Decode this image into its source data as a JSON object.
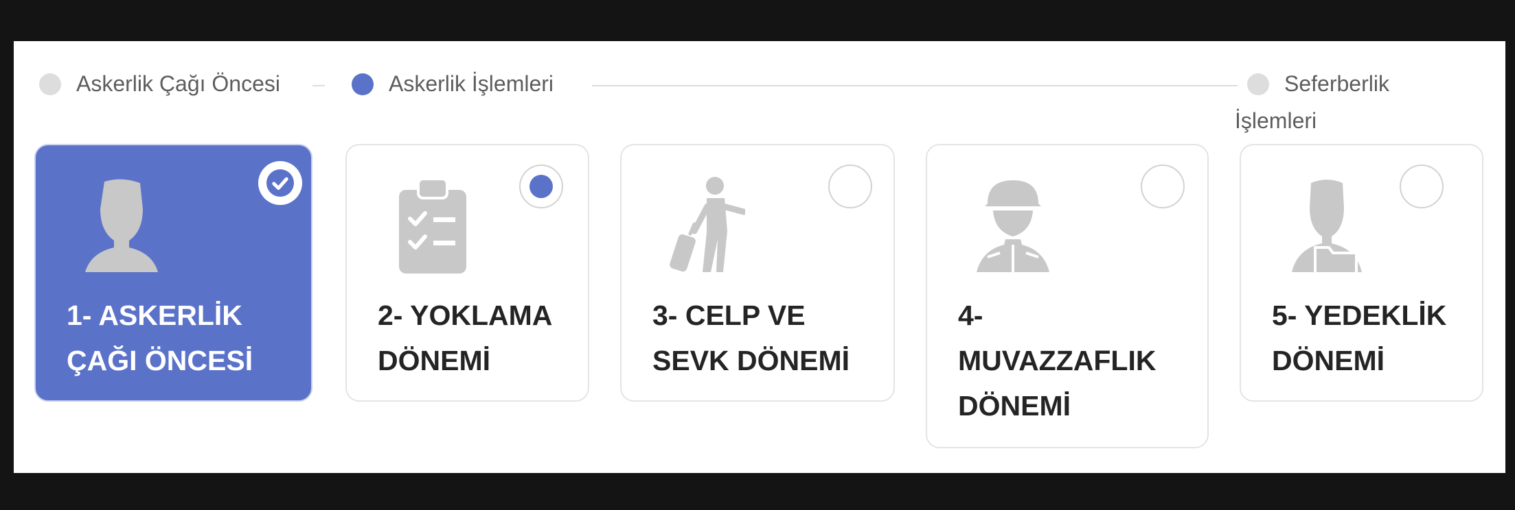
{
  "phases": [
    {
      "label": "Askerlik Çağı Öncesi",
      "state": "inactive"
    },
    {
      "label": "Askerlik İşlemleri",
      "state": "active"
    },
    {
      "label_line1": "Seferberlik",
      "label_line2": "İşlemleri",
      "state": "inactive"
    }
  ],
  "steps": [
    {
      "line1": "1- ASKERLİK",
      "line2": "ÇAĞI ÖNCESİ",
      "icon": "person-silhouette-icon",
      "status": "completed"
    },
    {
      "line1": "2- YOKLAMA",
      "line2": "DÖNEMİ",
      "icon": "clipboard-checklist-icon",
      "status": "current"
    },
    {
      "line1": "3- CELP VE",
      "line2": "SEVK DÖNEMİ",
      "icon": "traveler-with-luggage-icon",
      "status": "pending"
    },
    {
      "line1": "4-",
      "line2": "MUVAZZAFLIK",
      "line3": "DÖNEMİ",
      "icon": "soldier-helmet-icon",
      "status": "pending"
    },
    {
      "line1": "5- YEDEKLİK",
      "line2": "DÖNEMİ",
      "icon": "person-with-folder-icon",
      "status": "pending"
    }
  ],
  "colors": {
    "accent": "#5b72c9",
    "inactive_dot": "#dddddd",
    "card_border": "#e4e4e4",
    "icon_gray": "#c8c8c8",
    "title_text": "#242424",
    "phase_text": "#5d5d5d",
    "background": "#141414"
  }
}
